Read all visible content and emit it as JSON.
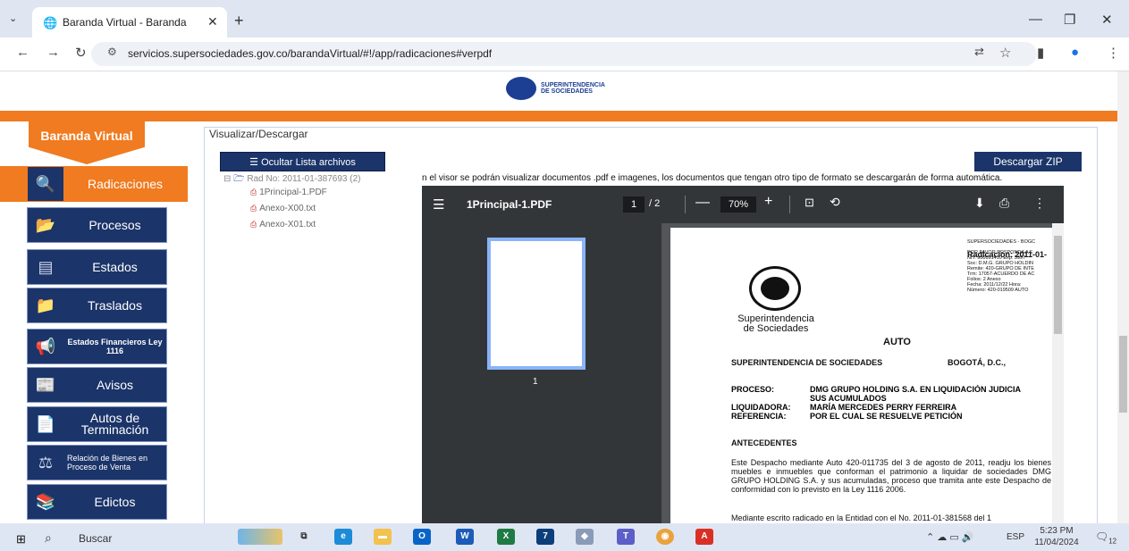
{
  "browser": {
    "tab_title": "Baranda Virtual - Baranda",
    "url": "servicios.supersociedades.gov.co/barandaVirtual/#!/app/radicaciones#verpdf"
  },
  "header": {
    "logo_line1": "SUPERINTENDENCIA",
    "logo_line2": "DE SOCIEDADES"
  },
  "sidebar": {
    "title": "Baranda Virtual",
    "items": [
      {
        "label": "Radicaciones",
        "icon": "search-document-icon",
        "active": true
      },
      {
        "label": "Procesos",
        "icon": "folder-icon"
      },
      {
        "label": "Estados",
        "icon": "list-document-icon"
      },
      {
        "label": "Traslados",
        "icon": "folder-arrow-icon"
      },
      {
        "label": "Estados Financieros Ley 1116",
        "icon": "megaphone-icon"
      },
      {
        "label": "Avisos",
        "icon": "newspaper-icon"
      },
      {
        "label": "Autos de Terminación",
        "icon": "document-icon"
      },
      {
        "label": "Relación de Bienes en Proceso de Venta",
        "icon": "gavel-icon"
      },
      {
        "label": "Edictos",
        "icon": "books-icon"
      }
    ]
  },
  "main": {
    "panel_title": "Visualizar/Descargar",
    "hide_list_button": "☰ Ocultar Lista archivos",
    "download_zip_button": "Descargar ZIP",
    "notice": "n el visor se podrán visualizar documentos .pdf e imagenes, los documentos que tengan otro tipo de formato se descargarán de forma automática.",
    "tree": {
      "root": "Rad No: 2011-01-387693 (2)",
      "files": [
        "1Principal-1.PDF",
        "Anexo-X00.txt",
        "Anexo-X01.txt"
      ]
    }
  },
  "viewer": {
    "filename": "1Principal-1.PDF",
    "current_page": "1",
    "total_pages": "/ 2",
    "zoom": "70%",
    "thumb_number": "1"
  },
  "document": {
    "stamp_lines": [
      "SUPERSOCIEDADES - BOGC",
      "POR FAVOR RESPONDA A E",
      "NIT: 900091410   Exp: 5997",
      "Soc: D.M.G. GRUPO HOLDIN",
      "Remite: 420-GRUPO DE INTE",
      "Trm: 17057-ACUERDO DE AC",
      "Folios: 2           Anexo",
      "Fecha: 2011/12/22   Hora:",
      "Número: 420-019509  AUTO"
    ],
    "radicacion": "Radicación: 2011-01-",
    "emblem_text1": "Superintendencia",
    "emblem_text2": "de Sociedades",
    "auto": "AUTO",
    "superintendencia": "SUPERINTENDENCIA DE SOCIEDADES",
    "bogota": "BOGOTÁ, D.C.,",
    "proceso_key": "PROCESO:",
    "proceso_val": "DMG GRUPO HOLDING S.A. EN LIQUIDACIÓN JUDICIA",
    "proceso_val2": "SUS ACUMULADOS",
    "liquidadora_key": "LIQUIDADORA:",
    "liquidadora_val": "MARÍA MERCEDES PERRY FERREIRA",
    "referencia_key": "REFERENCIA:",
    "referencia_val": "POR EL CUAL SE RESUELVE PETICIÓN",
    "antecedentes": "ANTECEDENTES",
    "p1": "Este Despacho mediante Auto 420-011735 del 3 de agosto de 2011, readju los bienes muebles e inmuebles que conforman el patrimonio a liquidar de sociedades DMG GRUPO HOLDING S.A. y sus acumuladas, proceso que tramita ante este Despacho de conformidad con lo previsto en la Ley 1116 2006.",
    "p2": "Mediante escrito radicado en la Entidad con el No. 2011-01-381568 del 1"
  },
  "taskbar": {
    "search": "Buscar",
    "lang": "ESP",
    "time": "5:23 PM",
    "date": "11/04/2024",
    "notif_count": "12"
  },
  "colors": {
    "orange": "#f07b20",
    "navy": "#1b3469"
  }
}
